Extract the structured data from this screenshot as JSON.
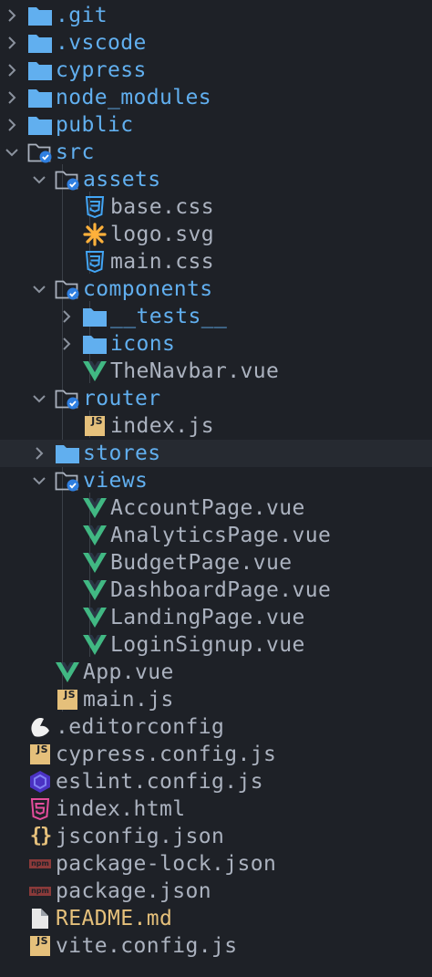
{
  "explorer": {
    "items": [
      {
        "name": ".git",
        "kind": "folder",
        "depth": 0,
        "chevron": "collapsed",
        "icon": "folder-icon"
      },
      {
        "name": ".vscode",
        "kind": "folder",
        "depth": 0,
        "chevron": "collapsed",
        "icon": "folder-icon"
      },
      {
        "name": "cypress",
        "kind": "folder",
        "depth": 0,
        "chevron": "collapsed",
        "icon": "folder-icon"
      },
      {
        "name": "node_modules",
        "kind": "folder",
        "depth": 0,
        "chevron": "collapsed",
        "icon": "folder-icon"
      },
      {
        "name": "public",
        "kind": "folder",
        "depth": 0,
        "chevron": "collapsed",
        "icon": "folder-icon"
      },
      {
        "name": "src",
        "kind": "folder",
        "depth": 0,
        "chevron": "expanded",
        "icon": "folder-open-icon"
      },
      {
        "name": "assets",
        "kind": "folder",
        "depth": 1,
        "chevron": "expanded",
        "icon": "folder-open-icon"
      },
      {
        "name": "base.css",
        "kind": "file",
        "depth": 2,
        "icon": "css-icon"
      },
      {
        "name": "logo.svg",
        "kind": "file",
        "depth": 2,
        "icon": "svg-icon"
      },
      {
        "name": "main.css",
        "kind": "file",
        "depth": 2,
        "icon": "css-icon"
      },
      {
        "name": "components",
        "kind": "folder",
        "depth": 1,
        "chevron": "expanded",
        "icon": "folder-open-icon"
      },
      {
        "name": "__tests__",
        "kind": "folder",
        "depth": 2,
        "chevron": "collapsed",
        "icon": "folder-icon"
      },
      {
        "name": "icons",
        "kind": "folder",
        "depth": 2,
        "chevron": "collapsed",
        "icon": "folder-icon"
      },
      {
        "name": "TheNavbar.vue",
        "kind": "file",
        "depth": 2,
        "icon": "vue-icon"
      },
      {
        "name": "router",
        "kind": "folder",
        "depth": 1,
        "chevron": "expanded",
        "icon": "folder-open-icon"
      },
      {
        "name": "index.js",
        "kind": "file",
        "depth": 2,
        "icon": "js-icon"
      },
      {
        "name": "stores",
        "kind": "folder",
        "depth": 1,
        "chevron": "collapsed",
        "icon": "folder-icon"
      },
      {
        "name": "views",
        "kind": "folder",
        "depth": 1,
        "chevron": "expanded",
        "icon": "folder-open-icon"
      },
      {
        "name": "AccountPage.vue",
        "kind": "file",
        "depth": 2,
        "icon": "vue-icon"
      },
      {
        "name": "AnalyticsPage.vue",
        "kind": "file",
        "depth": 2,
        "icon": "vue-icon"
      },
      {
        "name": "BudgetPage.vue",
        "kind": "file",
        "depth": 2,
        "icon": "vue-icon"
      },
      {
        "name": "DashboardPage.vue",
        "kind": "file",
        "depth": 2,
        "icon": "vue-icon"
      },
      {
        "name": "LandingPage.vue",
        "kind": "file",
        "depth": 2,
        "icon": "vue-icon"
      },
      {
        "name": "LoginSignup.vue",
        "kind": "file",
        "depth": 2,
        "icon": "vue-icon"
      },
      {
        "name": "App.vue",
        "kind": "file",
        "depth": 1,
        "icon": "vue-icon"
      },
      {
        "name": "main.js",
        "kind": "file",
        "depth": 1,
        "icon": "js-icon"
      },
      {
        "name": ".editorconfig",
        "kind": "file",
        "depth": 0,
        "icon": "editorconfig-icon"
      },
      {
        "name": "cypress.config.js",
        "kind": "file",
        "depth": 0,
        "icon": "js-icon"
      },
      {
        "name": "eslint.config.js",
        "kind": "file",
        "depth": 0,
        "icon": "eslint-icon"
      },
      {
        "name": "index.html",
        "kind": "file",
        "depth": 0,
        "icon": "html-icon"
      },
      {
        "name": "jsconfig.json",
        "kind": "file",
        "depth": 0,
        "icon": "json-icon"
      },
      {
        "name": "package-lock.json",
        "kind": "file",
        "depth": 0,
        "icon": "npm-icon"
      },
      {
        "name": "package.json",
        "kind": "file",
        "depth": 0,
        "icon": "npm-icon"
      },
      {
        "name": "README.md",
        "kind": "file",
        "depth": 0,
        "icon": "readme-icon",
        "modified": true
      },
      {
        "name": "vite.config.js",
        "kind": "file",
        "depth": 0,
        "icon": "js-icon"
      }
    ],
    "icon_labels": {
      "js": "JS",
      "npm": "npm",
      "json": "{}"
    },
    "colors": {
      "background": "#1e2127",
      "folder": "#61afef",
      "file_text": "#abb2bf",
      "modified_text": "#e5c07b",
      "vue": "#41b883",
      "css": "#42a5f5",
      "svg": "#ffb13b",
      "html": "#e44d9c",
      "eslint": "#4b32c3",
      "js": "#e5c07b",
      "npm": "#8a3a3a",
      "checkmark_badge": "#2f7fe0"
    }
  }
}
